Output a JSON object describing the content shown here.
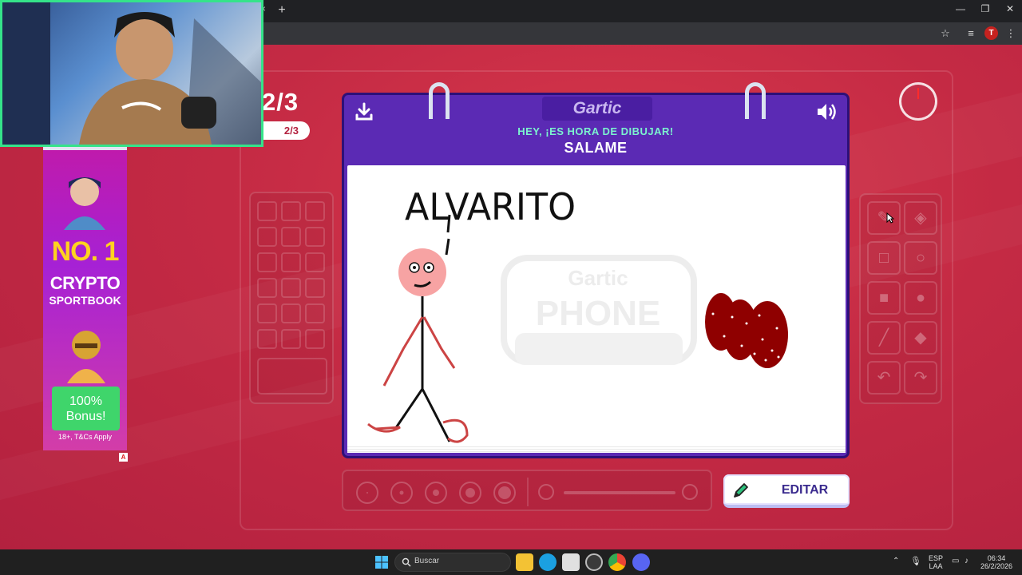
{
  "browser": {
    "new_tab": "+",
    "tab_close": "×",
    "window_controls": {
      "minimize": "—",
      "restore": "❐",
      "close": "✕"
    },
    "toolbar_icons": [
      "star-icon",
      "media-control-icon",
      "menu-icon"
    ],
    "profile_initial": "T"
  },
  "game": {
    "round_big": "2/3",
    "round_pill": "2/3",
    "logo": "Gartic",
    "prompt_sub": "HEY, ¡ES HORA DE DIBUJAR!",
    "prompt_word": "SALAME",
    "drawing_text": "ALVARITO",
    "watermark_top": "Gartic",
    "watermark_bottom": "PHONE",
    "edit_button": "EDITAR",
    "accent_color": "#5b2ab4",
    "background_color": "#c42a44"
  },
  "ad": {
    "headline": "NO. 1",
    "line2": "CRYPTO",
    "line3": "SPORTBOOK",
    "bonus": "100% Bonus!",
    "terms": "18+, T&Cs Apply",
    "badge": "A"
  },
  "taskbar": {
    "search_label": "Buscar",
    "lang_line1": "ESP",
    "lang_line2": "LAA",
    "time": "06:34",
    "date": "26/2/2026"
  }
}
